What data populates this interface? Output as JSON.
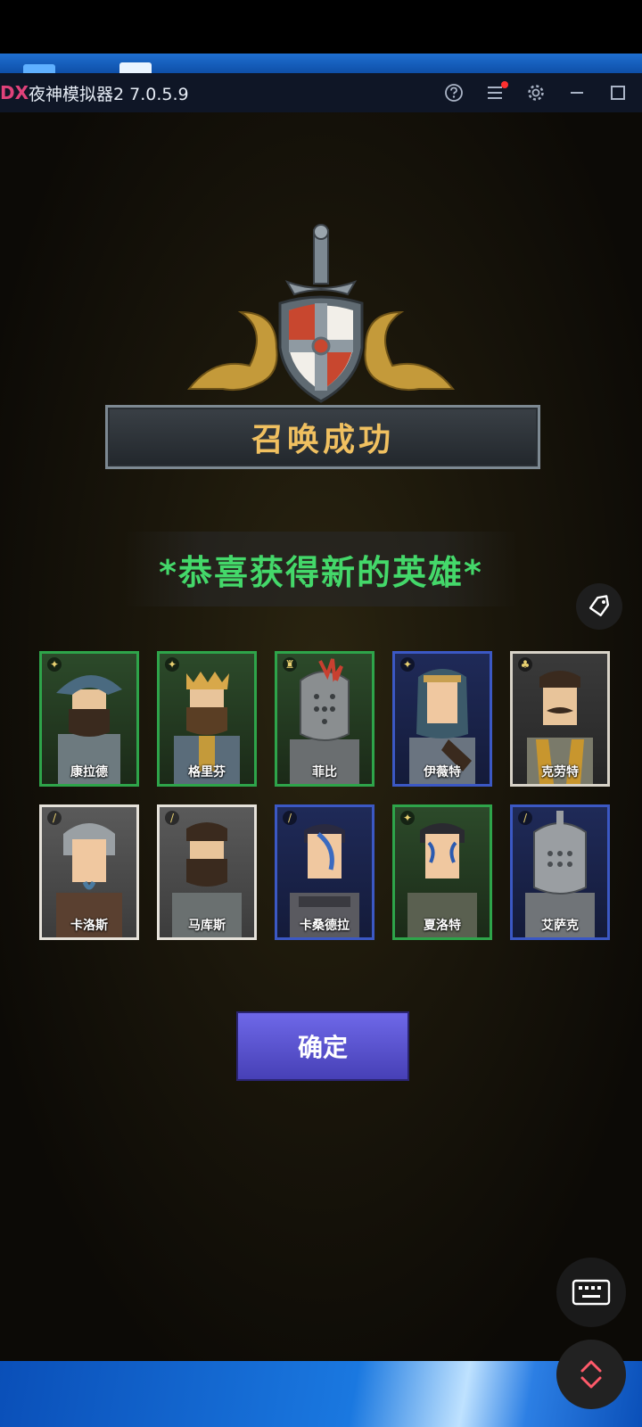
{
  "emulator": {
    "logo_text": "DX",
    "title": "夜神模拟器2 7.0.5.9",
    "icons": [
      "help-icon",
      "menu-icon",
      "settings-icon",
      "minimize-icon",
      "maximize-icon"
    ]
  },
  "dialog": {
    "banner_title": "召唤成功",
    "congrats_text": "*恭喜获得新的英雄*",
    "confirm_label": "确定"
  },
  "heroes": [
    {
      "name": "康拉德",
      "frame": "green"
    },
    {
      "name": "格里芬",
      "frame": "green"
    },
    {
      "name": "菲比",
      "frame": "green"
    },
    {
      "name": "伊薇特",
      "frame": "blue"
    },
    {
      "name": "克劳特",
      "frame": "gray"
    },
    {
      "name": "卡洛斯",
      "frame": "white"
    },
    {
      "name": "马库斯",
      "frame": "white"
    },
    {
      "name": "卡桑德拉",
      "frame": "blue"
    },
    {
      "name": "夏洛特",
      "frame": "green"
    },
    {
      "name": "艾萨克",
      "frame": "blue"
    }
  ],
  "overlay_buttons": [
    "tag-icon",
    "keyboard-icon",
    "expand-collapse-icon"
  ],
  "colors": {
    "banner_text": "#f0c060",
    "congrats_text": "#44d86a",
    "confirm_button": "#5b54d4",
    "frame_green": "#2ea44a",
    "frame_blue": "#3b58c4",
    "frame_white": "#e6e2da"
  }
}
